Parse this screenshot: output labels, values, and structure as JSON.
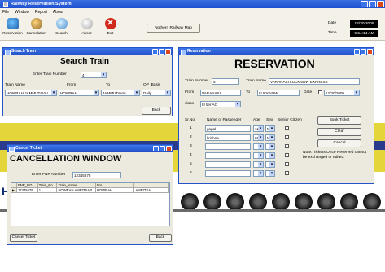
{
  "app": {
    "title": "Railway Reservation System"
  },
  "menu": [
    "File",
    "Window",
    "Report",
    "About"
  ],
  "toolbar": {
    "reservation": "Reservation",
    "cancelation": "Cancelation",
    "search": "Search",
    "about": "About",
    "exit": "Exit",
    "exit_icon": "✕",
    "map": "Nothern Railway Map"
  },
  "datetime": {
    "date_label": "Date",
    "date": "12/30/2009",
    "time_label": "Time",
    "time": "6:54:14 AM"
  },
  "background": {
    "letter": "H"
  },
  "search_window": {
    "title": "Search Train",
    "heading": "Search Train",
    "train_number_label": "Enter Train Number",
    "train_number": "4",
    "col_train_name": "Train Name",
    "col_from": "From",
    "col_to": "To",
    "col_op_basis": "OP_Basis",
    "train_name": "HOWRAH JAMMUTAVAI",
    "from": "HOWRAH",
    "to": "JAMMUTAVAI",
    "op_basis": "Daily",
    "back": "Back"
  },
  "reservation_window": {
    "title": "Reservation",
    "heading": "RESERVATION",
    "train_number_label": "Train Number",
    "train_number": "5",
    "train_name_label": "Train Name",
    "train_name": "VARANASI LUCKNOW EXPRESS",
    "from_label": "From",
    "from": "VARANASI",
    "to_label": "To",
    "to": "LUCKNOW",
    "date_label": "Date",
    "date": "12/30/2009",
    "class_label": "class",
    "class": "III tier AC",
    "headers": {
      "sno": "Sr.No.",
      "name": "Name of Passenger",
      "age": "Age",
      "sex": "Sex",
      "senior": "Senior Citizen"
    },
    "passengers": [
      {
        "sno": "1",
        "name": "gopal",
        "age": "12",
        "sex": "M"
      },
      {
        "sno": "2",
        "name": "krishna",
        "age": "23",
        "sex": "M"
      },
      {
        "sno": "3",
        "name": "",
        "age": "",
        "sex": ""
      },
      {
        "sno": "4",
        "name": "",
        "age": "",
        "sex": ""
      },
      {
        "sno": "5",
        "name": "",
        "age": "",
        "sex": ""
      },
      {
        "sno": "6",
        "name": "",
        "age": "",
        "sex": ""
      }
    ],
    "book": "Book Ticket",
    "clear": "Clear",
    "cancel": "Cancel",
    "note": "Note: Tickets Once Reserved cannot be exchanged or edited."
  },
  "cancel_window": {
    "title": "Cancel Ticket",
    "heading": "CANCELLATION WINDOW",
    "pnr_label": "Enter PNR Number",
    "pnr": "12345678",
    "columns": [
      "PNR_NO",
      "Train_No",
      "Train_Name",
      "Fro",
      ""
    ],
    "rows": [
      [
        "12345678",
        "1",
        "HOWRAH AMRITSAR",
        "HOWRAH",
        "AMRITSA"
      ]
    ],
    "cancel_ticket": "Cancel Ticket",
    "back": "Back"
  }
}
